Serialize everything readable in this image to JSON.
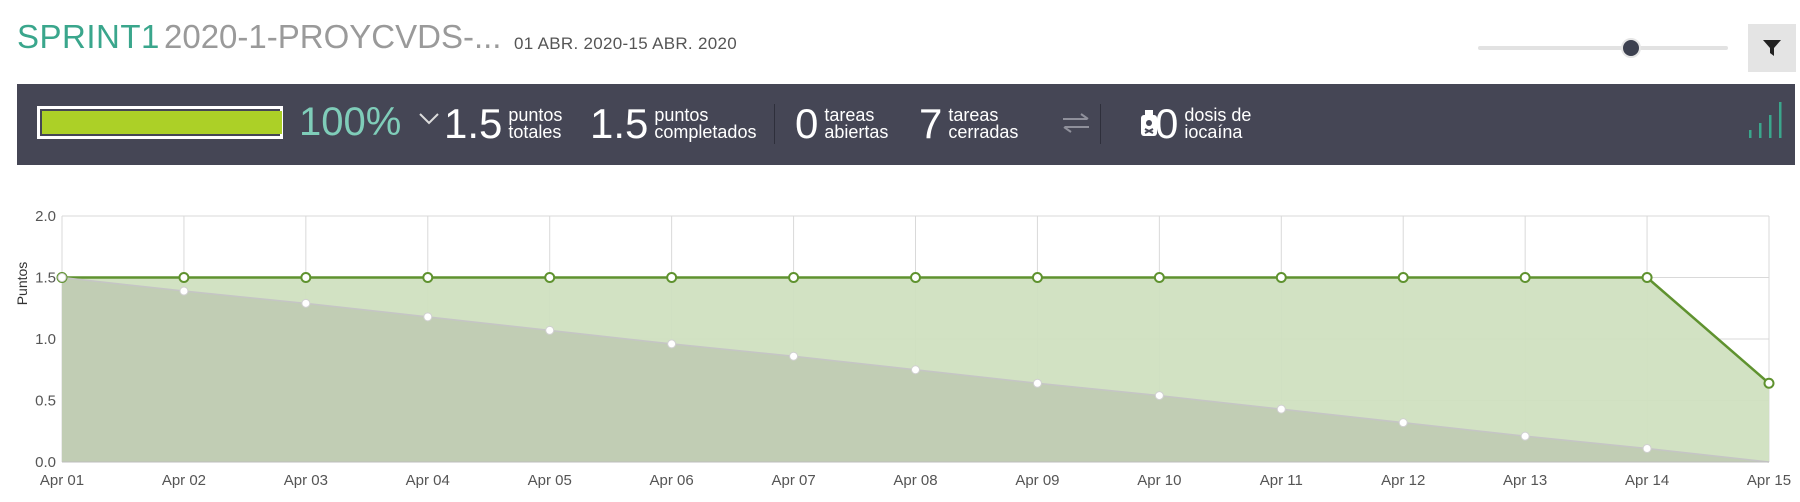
{
  "header": {
    "sprint_name": "SPRINT1",
    "project_name": "2020-1-PROYCVDS-...",
    "date_range": "01 ABR. 2020-15 ABR. 2020"
  },
  "slider": {
    "value": 0.62
  },
  "filter_button": {
    "icon": "filter-icon"
  },
  "stats": {
    "progress_percent": "100%",
    "progress_fraction": 1.0,
    "total_points": {
      "value": "1.5",
      "label_line1": "puntos",
      "label_line2": "totales"
    },
    "completed_points": {
      "value": "1.5",
      "label_line1": "puntos",
      "label_line2": "completados"
    },
    "open_tasks": {
      "value": "0",
      "label_line1": "tareas",
      "label_line2": "abiertas"
    },
    "closed_tasks": {
      "value": "7",
      "label_line1": "tareas",
      "label_line2": "cerradas"
    },
    "iocaine": {
      "value": "0",
      "label_line1": "dosis de",
      "label_line2": "iocaína"
    },
    "colors": {
      "bar_bg": "#454655",
      "progress_fill": "#acd027",
      "percent_text": "#7fcdb9",
      "accent": "#3aa68c"
    }
  },
  "chart_data": {
    "type": "area",
    "ylabel": "Puntos",
    "xlabel": "",
    "ylim": [
      0,
      2.0
    ],
    "yticks": [
      "0.0",
      "0.5",
      "1.0",
      "1.5",
      "2.0"
    ],
    "categories": [
      "Apr 01",
      "Apr 02",
      "Apr 03",
      "Apr 04",
      "Apr 05",
      "Apr 06",
      "Apr 07",
      "Apr 08",
      "Apr 09",
      "Apr 10",
      "Apr 11",
      "Apr 12",
      "Apr 13",
      "Apr 14",
      "Apr 15"
    ],
    "series": [
      {
        "values": [
          1.5,
          1.5,
          1.5,
          1.5,
          1.5,
          1.5,
          1.5,
          1.5,
          1.5,
          1.5,
          1.5,
          1.5,
          1.5,
          1.5,
          0.64
        ],
        "color": "#5f922f",
        "fill": "#d0e0c0"
      },
      {
        "values": [
          1.5,
          1.39,
          1.29,
          1.18,
          1.07,
          0.96,
          0.86,
          0.75,
          0.64,
          0.54,
          0.43,
          0.32,
          0.21,
          0.11,
          0.0
        ],
        "color": "#c5c5c5",
        "fill": "#bec9b2"
      }
    ],
    "grid": true
  }
}
